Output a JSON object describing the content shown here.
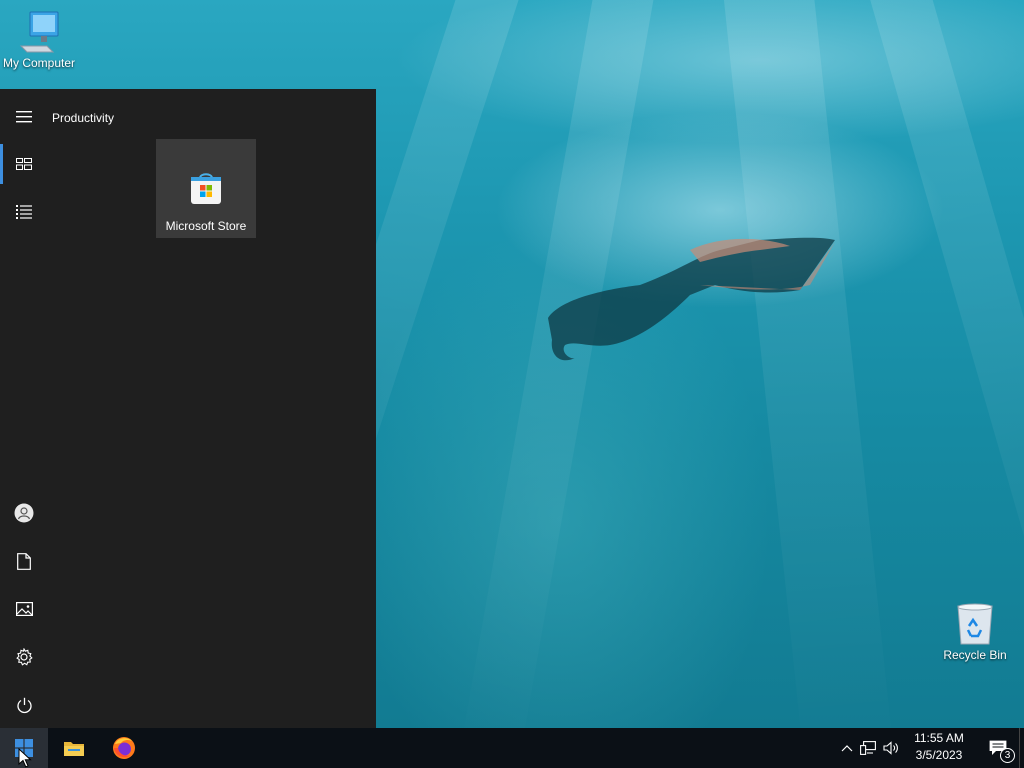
{
  "desktop": {
    "icons": [
      {
        "label": "My Computer",
        "icon": "computer-icon"
      },
      {
        "label": "Recycle Bin",
        "icon": "recycle-bin-icon"
      }
    ]
  },
  "start_menu": {
    "group_title": "Productivity",
    "tiles": [
      {
        "label": "Microsoft Store",
        "icon": "microsoft-store-icon"
      }
    ],
    "rail_top": [
      {
        "name": "expand-menu",
        "icon": "hamburger-icon"
      },
      {
        "name": "pinned-tiles",
        "icon": "tiles-icon",
        "active": true
      },
      {
        "name": "all-apps",
        "icon": "list-icon"
      }
    ],
    "rail_bottom": [
      {
        "name": "account",
        "icon": "user-icon"
      },
      {
        "name": "documents",
        "icon": "document-icon"
      },
      {
        "name": "pictures",
        "icon": "pictures-icon"
      },
      {
        "name": "settings",
        "icon": "gear-icon"
      },
      {
        "name": "power",
        "icon": "power-icon"
      }
    ]
  },
  "taskbar": {
    "pinned": [
      {
        "name": "start",
        "icon": "windows-icon"
      },
      {
        "name": "file-explorer",
        "icon": "folder-icon"
      },
      {
        "name": "firefox",
        "icon": "firefox-icon"
      }
    ],
    "tray": {
      "icons": [
        "chevron-up-icon",
        "network-icon",
        "volume-icon"
      ],
      "time": "11:55 AM",
      "date": "3/5/2023",
      "notification_count": "3"
    }
  },
  "colors": {
    "accent": "#3d8fe0",
    "start_menu_bg": "#1f1f1f",
    "taskbar_bg": "#0b1016",
    "tile_bg": "#3a3a3a"
  }
}
